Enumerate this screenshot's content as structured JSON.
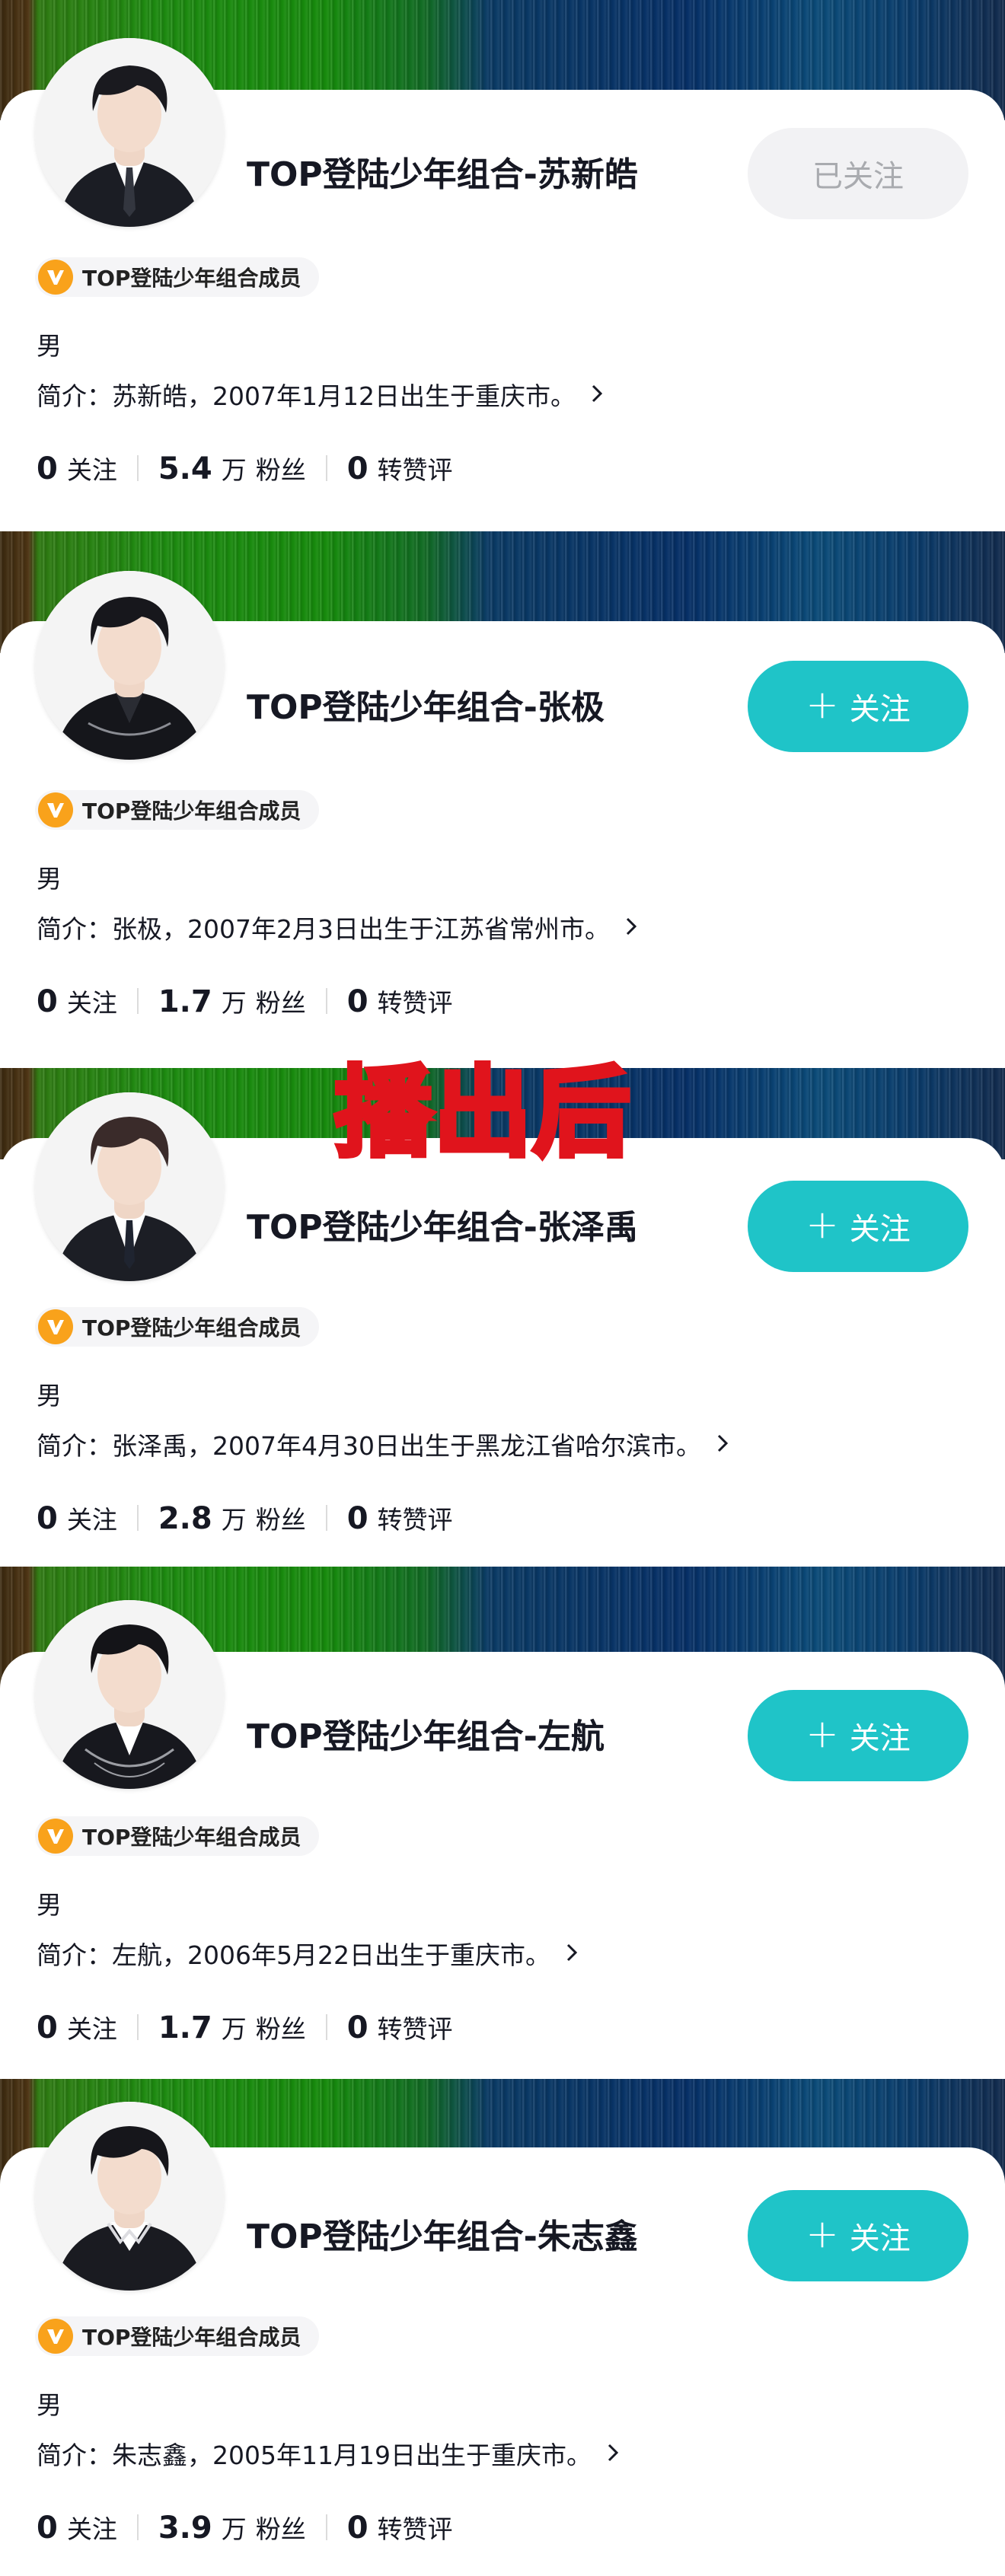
{
  "overlay_text": "播出后",
  "badge_label": "TOP登陆少年组合成员",
  "stat_labels": {
    "following": "关注",
    "followers": "粉丝",
    "likes": "转赞评"
  },
  "accent_color": "#1fc4c8",
  "badge_icon": "v-verified-icon",
  "cards": [
    {
      "name": "TOP登陆少年组合-苏新皓",
      "button_label": "已关注",
      "button_state": "following",
      "gender": "男",
      "bio": "简介：苏新皓，2007年1月12日出生于重庆市。",
      "following_count": "0",
      "followers_count": "5.4",
      "followers_unit": "万",
      "likes_count": "0"
    },
    {
      "name": "TOP登陆少年组合-张极",
      "button_label": "关注",
      "button_state": "follow",
      "gender": "男",
      "bio": "简介：张极，2007年2月3日出生于江苏省常州市。",
      "following_count": "0",
      "followers_count": "1.7",
      "followers_unit": "万",
      "likes_count": "0"
    },
    {
      "name": "TOP登陆少年组合-张泽禹",
      "button_label": "关注",
      "button_state": "follow",
      "gender": "男",
      "bio": "简介：张泽禹，2007年4月30日出生于黑龙江省哈尔滨市。",
      "following_count": "0",
      "followers_count": "2.8",
      "followers_unit": "万",
      "likes_count": "0"
    },
    {
      "name": "TOP登陆少年组合-左航",
      "button_label": "关注",
      "button_state": "follow",
      "gender": "男",
      "bio": "简介：左航，2006年5月22日出生于重庆市。",
      "following_count": "0",
      "followers_count": "1.7",
      "followers_unit": "万",
      "likes_count": "0"
    },
    {
      "name": "TOP登陆少年组合-朱志鑫",
      "button_label": "关注",
      "button_state": "follow",
      "gender": "男",
      "bio": "简介：朱志鑫，2005年11月19日出生于重庆市。",
      "following_count": "0",
      "followers_count": "3.9",
      "followers_unit": "万",
      "likes_count": "0"
    }
  ]
}
